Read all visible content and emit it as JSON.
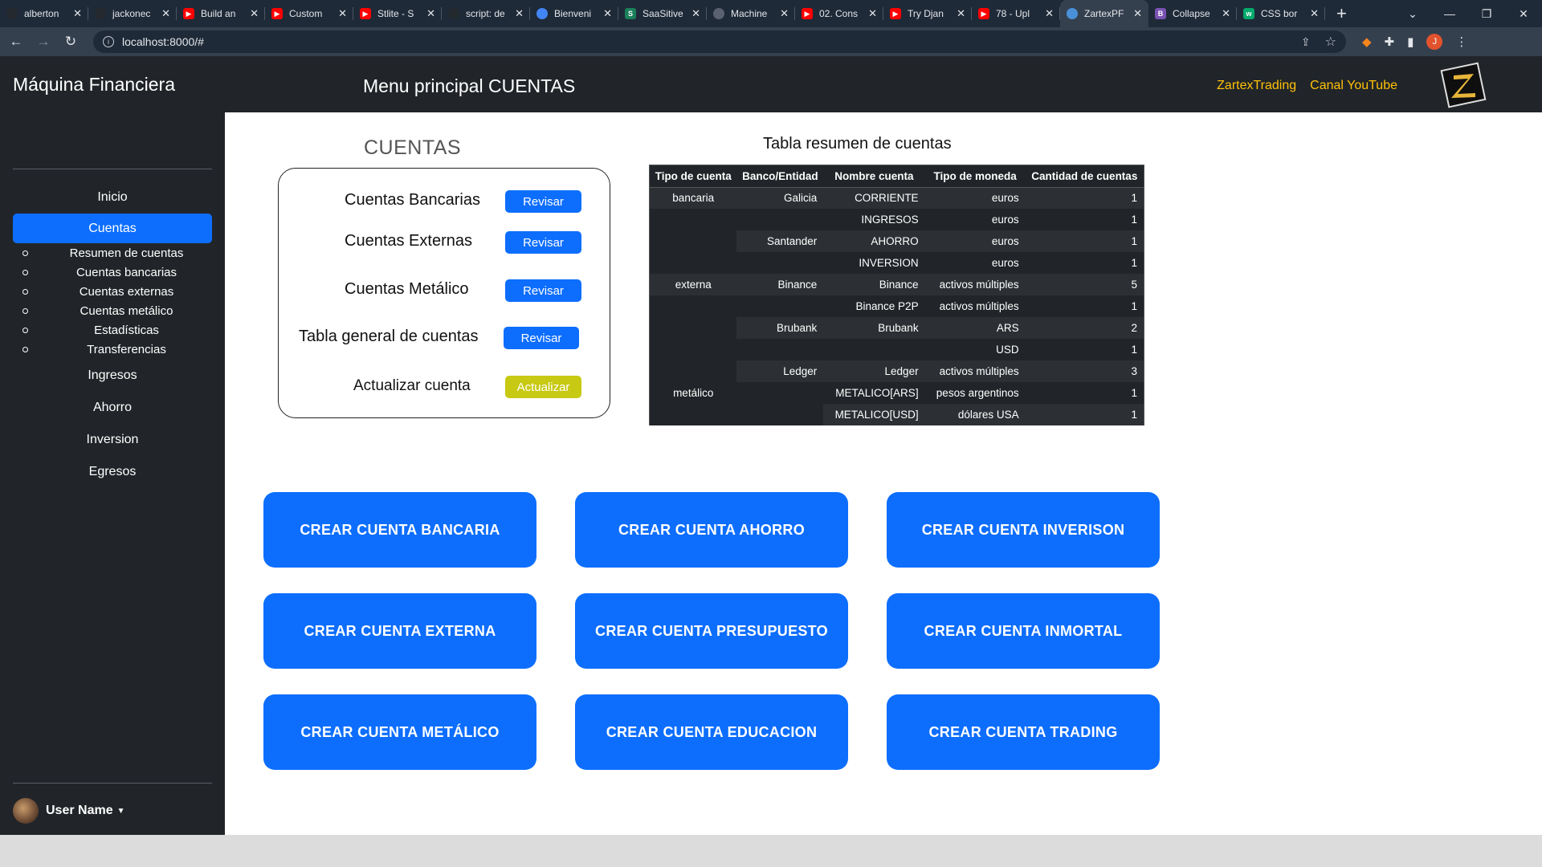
{
  "browser": {
    "tabs": [
      {
        "title": "alberton",
        "icon": "github-icon",
        "color": "#24292f"
      },
      {
        "title": "jackonec",
        "icon": "github-icon",
        "color": "#24292f"
      },
      {
        "title": "Build an",
        "icon": "youtube-icon",
        "color": "#ff0000"
      },
      {
        "title": "Custom",
        "icon": "youtube-icon",
        "color": "#ff0000"
      },
      {
        "title": "Stlite - S",
        "icon": "youtube-icon",
        "color": "#ff0000"
      },
      {
        "title": "script: de",
        "icon": "github-icon",
        "color": "#24292f"
      },
      {
        "title": "Bienveni",
        "icon": "cloud-icon",
        "color": "#4285f4"
      },
      {
        "title": "SaaSitive",
        "icon": "saas-icon",
        "color": "#1a7f5a"
      },
      {
        "title": "Machine",
        "icon": "rocket-icon",
        "color": "#5a6270"
      },
      {
        "title": "02. Cons",
        "icon": "youtube-icon",
        "color": "#ff0000"
      },
      {
        "title": "Try Djan",
        "icon": "youtube-icon",
        "color": "#ff0000"
      },
      {
        "title": "78 - Upl",
        "icon": "youtube-icon",
        "color": "#ff0000"
      },
      {
        "title": "ZartexPF",
        "icon": "globe-icon",
        "color": "#4a90d9"
      },
      {
        "title": "Collapse",
        "icon": "bootstrap-icon",
        "color": "#7952b3"
      },
      {
        "title": "CSS bor",
        "icon": "w3-icon",
        "color": "#04aa6d"
      }
    ],
    "url": "localhost:8000/#",
    "profile_initial": "J"
  },
  "header": {
    "brand": "Máquina Financiera",
    "title": "Menu principal CUENTAS",
    "links": [
      "ZartexTrading",
      "Canal YouTube"
    ]
  },
  "sidebar": {
    "items": {
      "inicio": "Inicio",
      "cuentas": "Cuentas",
      "ingresos": "Ingresos",
      "ahorro": "Ahorro",
      "inversion": "Inversion",
      "egresos": "Egresos"
    },
    "subitems": [
      "Resumen de cuentas",
      "Cuentas bancarias",
      "Cuentas externas",
      "Cuentas metálico",
      "Estadísticas",
      "Transferencias"
    ],
    "user": "User Name"
  },
  "cuentas": {
    "title": "CUENTAS",
    "rows": [
      {
        "label": "Cuentas Bancarias",
        "button": "Revisar"
      },
      {
        "label": "Cuentas Externas",
        "button": "Revisar"
      },
      {
        "label": "Cuentas Metálico",
        "button": "Revisar"
      },
      {
        "label": "Tabla general de cuentas",
        "button": "Revisar"
      },
      {
        "label": "Actualizar cuenta",
        "button": "Actualizar"
      }
    ]
  },
  "summary_table": {
    "title": "Tabla resumen de cuentas",
    "headers": [
      "Tipo de cuenta",
      "Banco/Entidad",
      "Nombre cuenta",
      "Tipo de moneda",
      "Cantidad de cuentas"
    ],
    "rows": [
      [
        "bancaria",
        "Galicia",
        "CORRIENTE",
        "euros",
        "1"
      ],
      [
        "",
        "",
        "INGRESOS",
        "euros",
        "1"
      ],
      [
        "",
        "Santander",
        "AHORRO",
        "euros",
        "1"
      ],
      [
        "",
        "",
        "INVERSION",
        "euros",
        "1"
      ],
      [
        "externa",
        "Binance",
        "Binance",
        "activos múltiples",
        "5"
      ],
      [
        "",
        "",
        "Binance P2P",
        "activos múltiples",
        "1"
      ],
      [
        "",
        "Brubank",
        "Brubank",
        "ARS",
        "2"
      ],
      [
        "",
        "",
        "",
        "USD",
        "1"
      ],
      [
        "",
        "Ledger",
        "Ledger",
        "activos múltiples",
        "3"
      ],
      [
        "metálico",
        "",
        "METALICO[ARS]",
        "pesos argentinos",
        "1"
      ],
      [
        "",
        "",
        "METALICO[USD]",
        "dólares USA",
        "1"
      ]
    ]
  },
  "create_buttons": [
    "CREAR CUENTA BANCARIA",
    "CREAR CUENTA AHORRO",
    "CREAR CUENTA INVERISON",
    "CREAR CUENTA EXTERNA",
    "CREAR CUENTA PRESUPUESTO",
    "CREAR CUENTA INMORTAL",
    "CREAR CUENTA METÁLICO",
    "CREAR CUENTA EDUCACION",
    "CREAR CUENTA TRADING"
  ],
  "colors": {
    "primary": "#0d6efd",
    "warning_link": "#ffc107",
    "update_button": "#c7c913",
    "dark": "#212529"
  }
}
